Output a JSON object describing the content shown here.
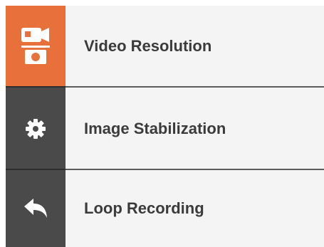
{
  "menu": {
    "items": [
      {
        "label": "Video Resolution",
        "icon": "camera-icon",
        "active": true
      },
      {
        "label": "Image Stabilization",
        "icon": "gear-icon",
        "active": false
      },
      {
        "label": "Loop Recording",
        "icon": "back-arrow-icon",
        "active": false
      }
    ]
  },
  "colors": {
    "active_icon_bg": "#e8703a",
    "icon_bg": "#4a4a4a",
    "label_bg": "#f4f4f4",
    "separator_dark": "#2e2e2e",
    "separator_light": "#5c5c5c",
    "label_text": "#3b3b3b",
    "icon_fg": "#ffffff"
  }
}
